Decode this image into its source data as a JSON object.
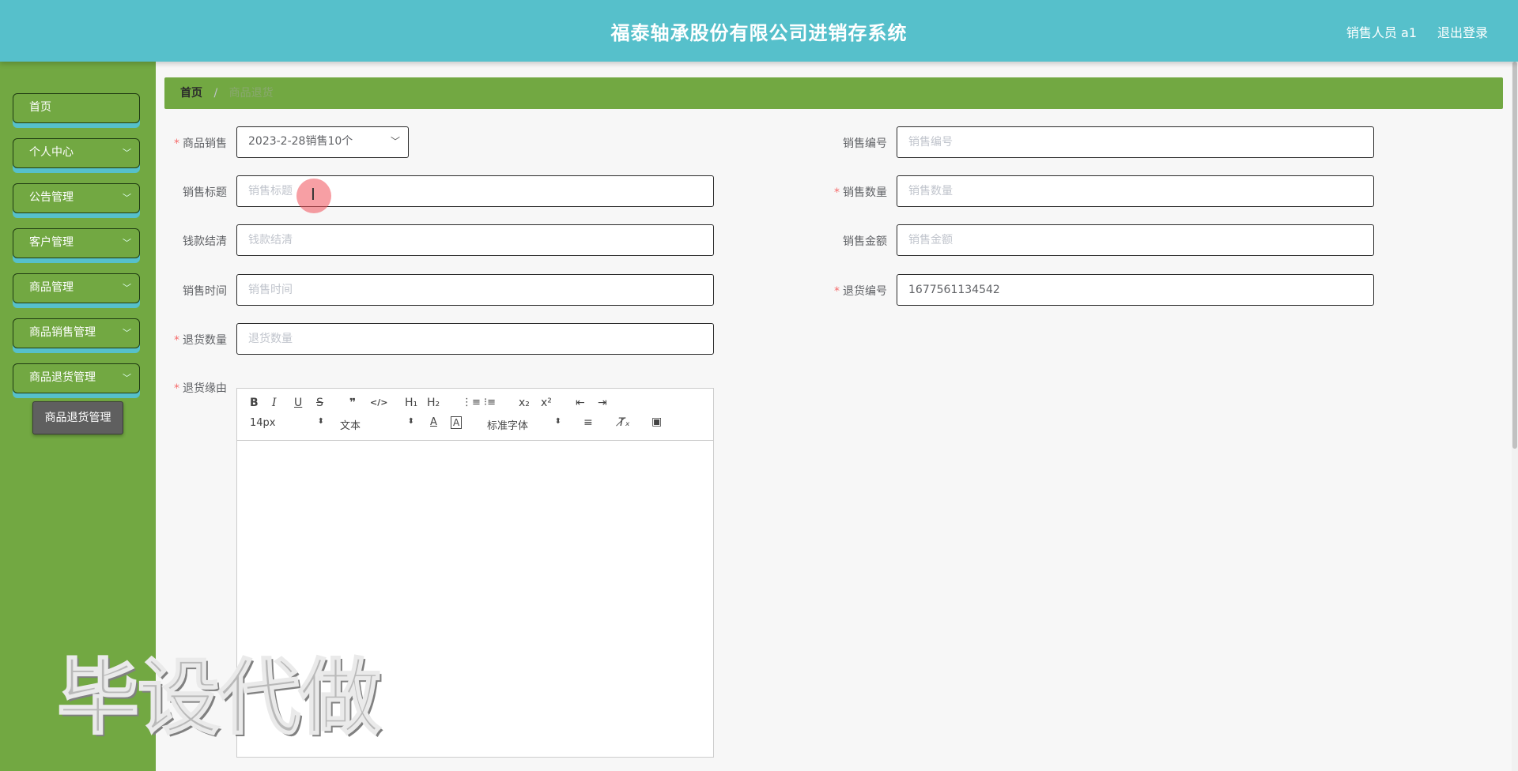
{
  "header": {
    "title": "福泰轴承股份有限公司进销存系统",
    "user": "销售人员 a1",
    "logout": "退出登录"
  },
  "sidebar": {
    "items": [
      {
        "label": "首页"
      },
      {
        "label": "个人中心"
      },
      {
        "label": "公告管理"
      },
      {
        "label": "客户管理"
      },
      {
        "label": "商品管理"
      },
      {
        "label": "商品销售管理"
      },
      {
        "label": "商品退货管理"
      }
    ],
    "submenu_item": "商品退货管理"
  },
  "breadcrumb": {
    "home": "首页",
    "separator": "/",
    "current": "商品退货"
  },
  "form": {
    "product_sale": {
      "label": "商品销售",
      "value": "2023-2-28销售10个"
    },
    "sale_no": {
      "label": "销售编号",
      "placeholder": "销售编号"
    },
    "sale_title": {
      "label": "销售标题",
      "placeholder": "销售标题"
    },
    "sale_qty": {
      "label": "销售数量",
      "placeholder": "销售数量"
    },
    "settled": {
      "label": "钱款结清",
      "placeholder": "钱款结清"
    },
    "sale_amount": {
      "label": "销售金额",
      "placeholder": "销售金额"
    },
    "sale_time": {
      "label": "销售时间",
      "placeholder": "销售时间"
    },
    "return_no": {
      "label": "退货编号",
      "value": "1677561134542"
    },
    "return_qty": {
      "label": "退货数量",
      "placeholder": "退货数量"
    },
    "return_reason": {
      "label": "退货缘由"
    },
    "required_mark": "*"
  },
  "editor": {
    "font_size": "14px",
    "header_type": "文本",
    "font_family": "标准字体",
    "buttons": {
      "bold": "B",
      "italic": "I",
      "underline": "U",
      "strike": "S",
      "quote": "❞",
      "code": "</>",
      "h1": "H₁",
      "h2": "H₂",
      "ordered": "⋮≡",
      "bullet": "⁝≡",
      "sub": "x₂",
      "sup": "x²",
      "outdent": "⇤",
      "indent": "⇥",
      "color": "A",
      "background": "A",
      "align": "≡",
      "clean": "T̸ₓ",
      "image": "▣"
    }
  },
  "watermark": "毕设代做",
  "colors": {
    "header": "#56c0cb",
    "sidebar": "#72a842",
    "required": "#f56c6c"
  }
}
